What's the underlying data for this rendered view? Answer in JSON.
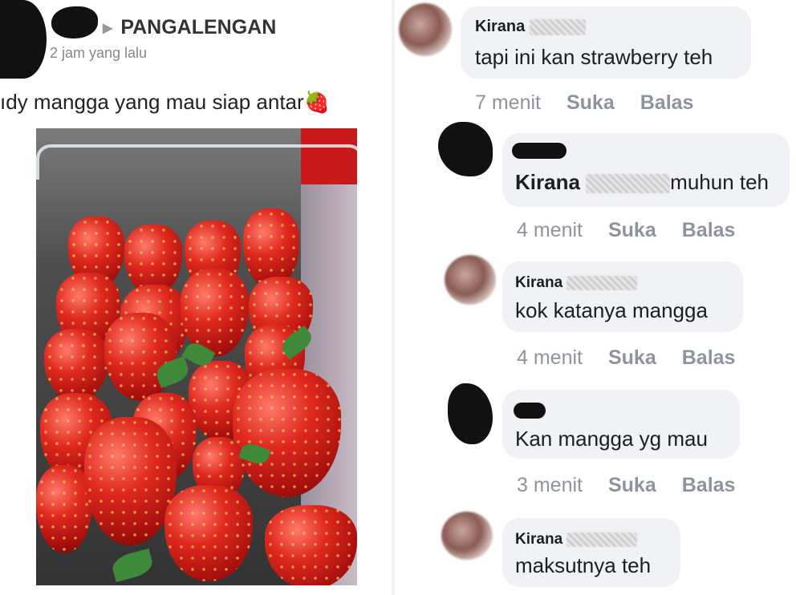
{
  "post": {
    "location": "PANGALENGAN",
    "time": "2 jam yang lalu",
    "text": "ıdy mangga yang mau siap antar",
    "emoji": "🍓"
  },
  "comments": [
    {
      "name": "Kirana",
      "text": "tapi ini kan strawberry teh",
      "time": "7 menit",
      "like": "Suka",
      "reply": "Balas"
    },
    {
      "name": "",
      "tag": "Kirana",
      "text": "muhun teh",
      "time": "4 menit",
      "like": "Suka",
      "reply": "Balas"
    },
    {
      "name": "Kirana",
      "text": "kok katanya mangga",
      "time": "4 menit",
      "like": "Suka",
      "reply": "Balas"
    },
    {
      "name": "",
      "text": "Kan mangga yg mau",
      "time": "3 menit",
      "like": "Suka",
      "reply": "Balas"
    },
    {
      "name": "Kirana",
      "text": "maksutnya teh"
    }
  ]
}
